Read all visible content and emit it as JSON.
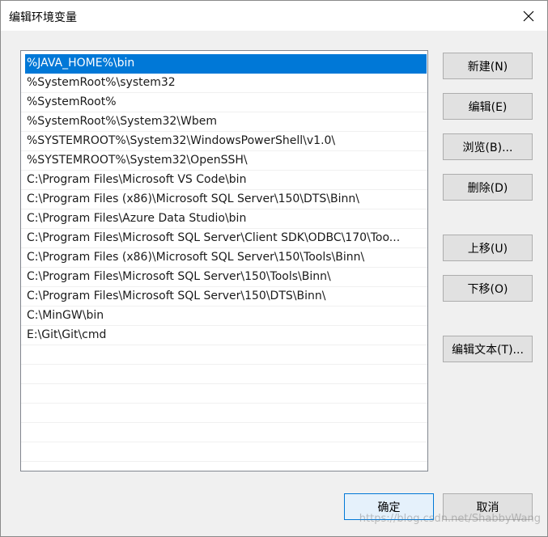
{
  "window": {
    "title": "编辑环境变量",
    "close_icon": "close-icon"
  },
  "paths": [
    "%JAVA_HOME%\\bin",
    "%SystemRoot%\\system32",
    "%SystemRoot%",
    "%SystemRoot%\\System32\\Wbem",
    "%SYSTEMROOT%\\System32\\WindowsPowerShell\\v1.0\\",
    "%SYSTEMROOT%\\System32\\OpenSSH\\",
    "C:\\Program Files\\Microsoft VS Code\\bin",
    "C:\\Program Files (x86)\\Microsoft SQL Server\\150\\DTS\\Binn\\",
    "C:\\Program Files\\Azure Data Studio\\bin",
    "C:\\Program Files\\Microsoft SQL Server\\Client SDK\\ODBC\\170\\Too...",
    "C:\\Program Files (x86)\\Microsoft SQL Server\\150\\Tools\\Binn\\",
    "C:\\Program Files\\Microsoft SQL Server\\150\\Tools\\Binn\\",
    "C:\\Program Files\\Microsoft SQL Server\\150\\DTS\\Binn\\",
    "C:\\MinGW\\bin",
    "E:\\Git\\Git\\cmd"
  ],
  "selected_index": 0,
  "buttons": {
    "new": "新建(N)",
    "edit": "编辑(E)",
    "browse": "浏览(B)...",
    "delete": "删除(D)",
    "move_up": "上移(U)",
    "move_down": "下移(O)",
    "edit_text": "编辑文本(T)...",
    "ok": "确定",
    "cancel": "取消"
  },
  "watermark": "https://blog.csdn.net/ShabbyWang",
  "colors": {
    "selection": "#0078d7",
    "dialog_background": "#f0f0f0",
    "button_face": "#e1e1e1"
  }
}
